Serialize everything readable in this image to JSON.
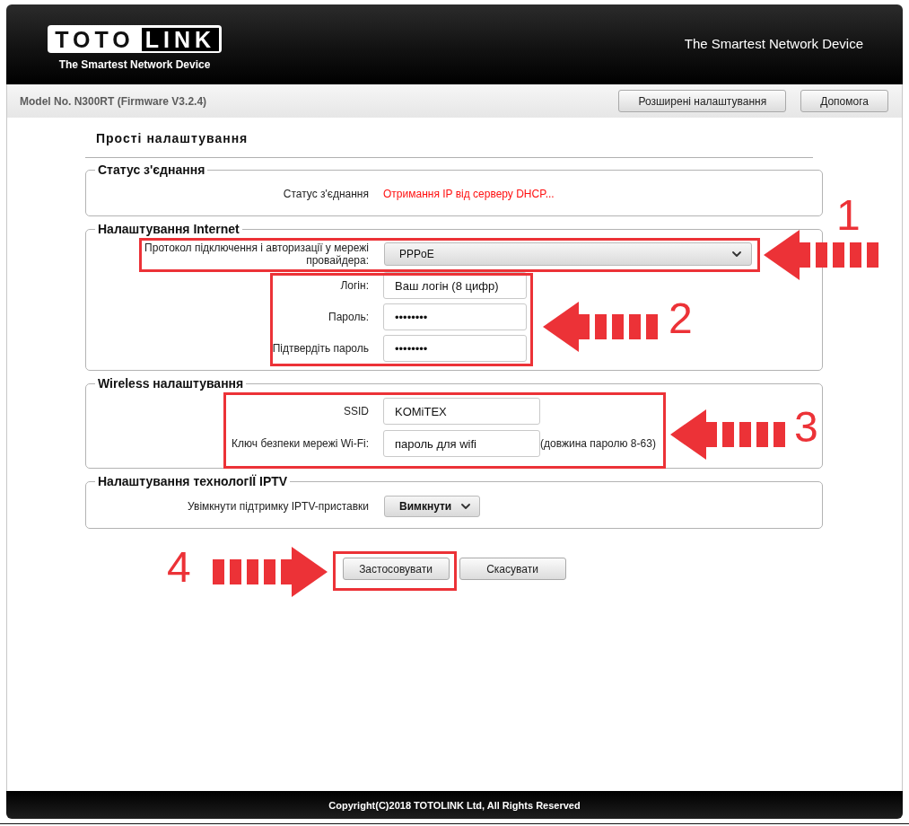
{
  "header": {
    "logo_words": [
      "TOTO",
      "LINK"
    ],
    "tagline": "The Smartest Network Device",
    "slogan": "The Smartest Network Device"
  },
  "toolbar": {
    "model": "Model No. N300RT (Firmware V3.2.4)",
    "buttons": [
      "Розширені налаштування",
      "Допомога"
    ]
  },
  "page_title": "Прості налаштування",
  "sections": [
    {
      "title": "Статус з'єднання",
      "rows": [
        {
          "kind": "status",
          "label": "Статус з'єднання",
          "value": "Отримання IP від серверу DHCP..."
        }
      ]
    },
    {
      "title": "Налаштування Internet",
      "rows": [
        {
          "kind": "dropdown",
          "label": "Протокол підключення і авторизації у мережі провайдера:",
          "value": "PPPoE"
        },
        {
          "kind": "input",
          "label": "Логін:",
          "value": "Ваш логін (8 цифр)"
        },
        {
          "kind": "input",
          "label": "Пароль:",
          "value": "••••••••"
        },
        {
          "kind": "input",
          "label": "Підтвердіть пароль",
          "value": "••••••••"
        }
      ]
    },
    {
      "title": "Wireless налаштування",
      "rows": [
        {
          "kind": "input",
          "label": "SSID",
          "value": "KOMiTEX"
        },
        {
          "kind": "input",
          "label": "Ключ безпеки мережі Wi-Fi:",
          "value": "пароль для wifi",
          "hint": "(довжина паролю 8-63)"
        }
      ]
    },
    {
      "title": "Налаштування технологІЇ IPTV",
      "rows": [
        {
          "kind": "menu",
          "label": "Увімкнути підтримку IPTV-приставки",
          "value": "Вимкнути"
        }
      ]
    }
  ],
  "actions": [
    "Застосовувати",
    "Скасувати"
  ],
  "footer": {
    "copyright": "Copyright(C)2018 TOTOLINK Ltd, All Rights Reserved"
  },
  "annotations": [
    {
      "number": "1",
      "kind": "leftward"
    },
    {
      "number": "2",
      "kind": "leftward"
    },
    {
      "number": "3",
      "kind": "leftward"
    },
    {
      "number": "4",
      "kind": "rightward"
    }
  ]
}
